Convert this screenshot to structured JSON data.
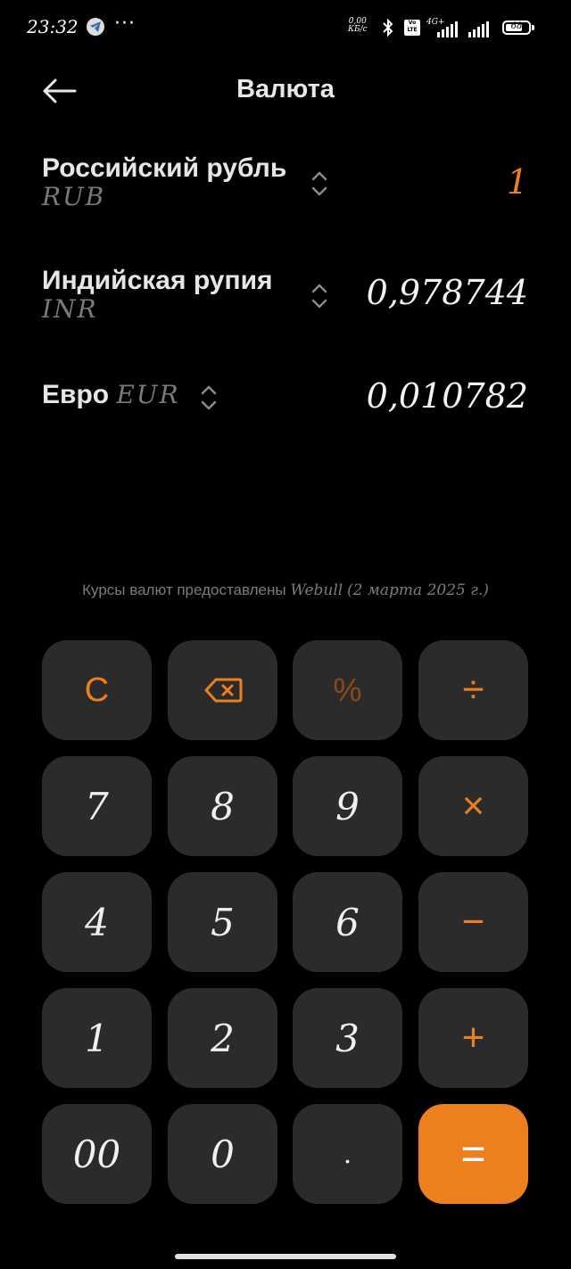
{
  "status_bar": {
    "time": "23:32",
    "more_indicator": "···",
    "net_speed_value": "0,00",
    "net_speed_unit": "КБ/с",
    "volte_label": "Vo LTE",
    "network_type": "4G+",
    "battery_level": "68"
  },
  "header": {
    "title": "Валюта",
    "back_icon": "arrow-left-icon"
  },
  "currencies": [
    {
      "name": "Российский рубль",
      "code": "RUB",
      "value": "1",
      "active": true
    },
    {
      "name": "Индийская рупия",
      "code": "INR",
      "value": "0,978744",
      "active": false
    },
    {
      "name": "Евро",
      "code": "EUR",
      "value": "0,010782",
      "active": false
    }
  ],
  "rates_note": {
    "prefix": "Курсы валют предоставлены",
    "provider": "Webull",
    "date": "(2 марта 2025 г.)"
  },
  "keypad": {
    "clear": "C",
    "backspace_icon": "backspace-icon",
    "percent": "%",
    "divide": "÷",
    "multiply": "×",
    "minus": "−",
    "plus": "+",
    "equals": "=",
    "digits": [
      "7",
      "8",
      "9",
      "4",
      "5",
      "6",
      "1",
      "2",
      "3",
      "00",
      "0",
      "."
    ]
  },
  "colors": {
    "accent": "#ec7f1e",
    "key_bg": "#2b2b2b",
    "background": "#000000"
  }
}
